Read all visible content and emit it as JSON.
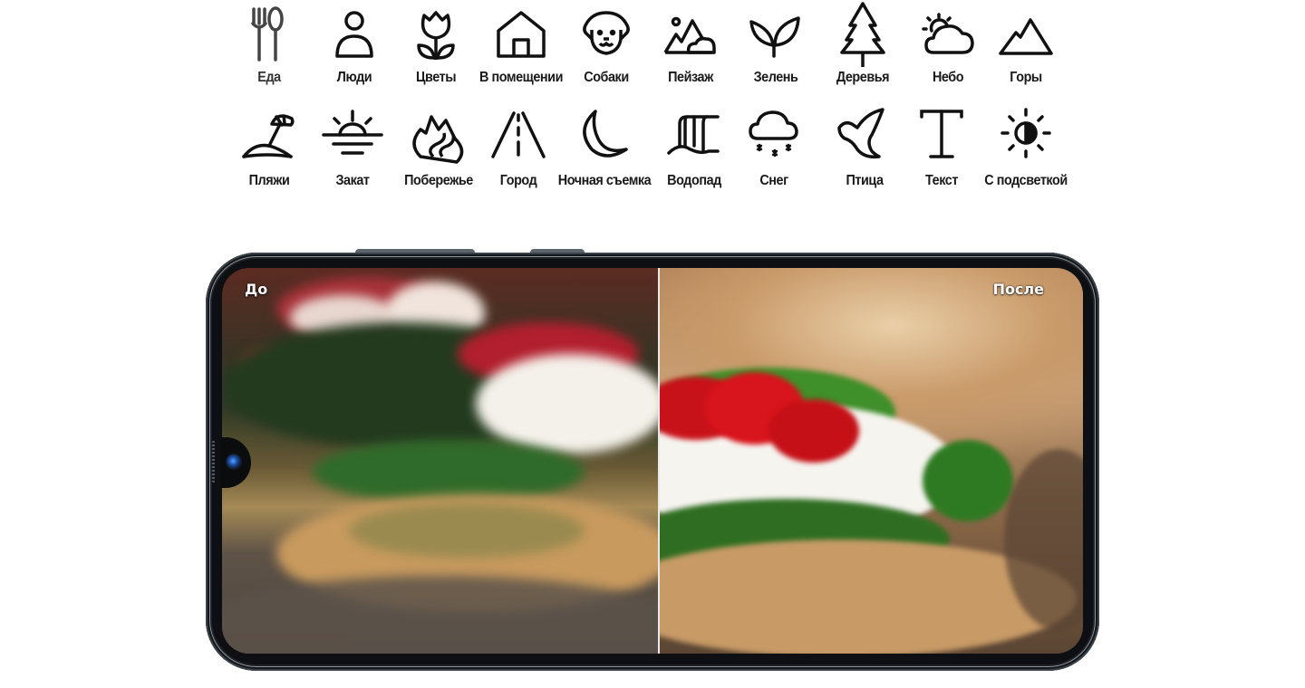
{
  "scene_icons": {
    "row1": [
      {
        "label": "Еда",
        "icon": "fork-spoon-icon"
      },
      {
        "label": "Люди",
        "icon": "person-icon"
      },
      {
        "label": "Цветы",
        "icon": "tulip-icon"
      },
      {
        "label": "В помещении",
        "icon": "house-icon"
      },
      {
        "label": "Собаки",
        "icon": "dog-icon"
      },
      {
        "label": "Пейзаж",
        "icon": "landscape-icon"
      },
      {
        "label": "Зелень",
        "icon": "sprout-icon"
      },
      {
        "label": "Деревья",
        "icon": "tree-icon"
      },
      {
        "label": "Небо",
        "icon": "sun-cloud-icon"
      },
      {
        "label": "Горы",
        "icon": "mountain-icon"
      }
    ],
    "row2": [
      {
        "label": "Пляжи",
        "icon": "beach-umbrella-icon"
      },
      {
        "label": "Закат",
        "icon": "sunset-icon"
      },
      {
        "label": "Побережье",
        "icon": "coast-icon"
      },
      {
        "label": "Город",
        "icon": "road-icon"
      },
      {
        "label": "Ночная съемка",
        "icon": "moon-icon"
      },
      {
        "label": "Водопад",
        "icon": "waterfall-icon"
      },
      {
        "label": "Снег",
        "icon": "snow-cloud-icon"
      },
      {
        "label": "Птица",
        "icon": "bird-icon"
      },
      {
        "label": "Текст",
        "icon": "text-t-icon"
      },
      {
        "label": "С подсветкой",
        "icon": "backlight-icon"
      }
    ]
  },
  "phone": {
    "comparison": {
      "before_label": "До",
      "after_label": "После"
    }
  }
}
